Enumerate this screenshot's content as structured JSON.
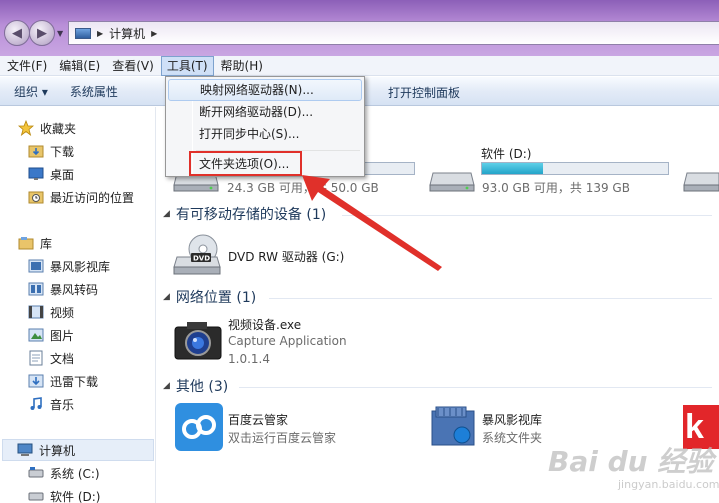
{
  "address": {
    "crumb": "计算机"
  },
  "menubar": [
    {
      "label": "文件(F)"
    },
    {
      "label": "编辑(E)"
    },
    {
      "label": "查看(V)"
    },
    {
      "label": "工具(T)"
    },
    {
      "label": "帮助(H)"
    }
  ],
  "cmdbar": {
    "organize": "组织 ▾",
    "properties": "系统属性",
    "control_panel": "打开控制面板"
  },
  "tools_menu": {
    "items": [
      {
        "label": "映射网络驱动器(N)..."
      },
      {
        "label": "断开网络驱动器(D)..."
      },
      {
        "label": "打开同步中心(S)..."
      },
      {
        "label": "文件夹选项(O)..."
      }
    ]
  },
  "nav": {
    "favorites": "收藏夹",
    "downloads": "下载",
    "desktop": "桌面",
    "recent": "最近访问的位置",
    "libraries": "库",
    "lib_video_lib": "暴风影视库",
    "lib_transcode": "暴风转码",
    "lib_videos": "视频",
    "lib_pictures": "图片",
    "lib_docs": "文档",
    "lib_xunlei": "迅雷下载",
    "lib_music": "音乐",
    "computer": "计算机",
    "sys_c": "系统 (C:)",
    "soft_d": "软件 (D:)"
  },
  "drives": {
    "c_free": "24.3 GB 可用，共 50.0 GB",
    "c_fill": 0.51,
    "d_name": "软件 (D:)",
    "d_free": "93.0 GB 可用，共 139 GB",
    "d_fill": 0.33
  },
  "groups": {
    "removable": "有可移动存储的设备 (1)",
    "network": "网络位置 (1)",
    "other": "其他 (3)"
  },
  "dvd": {
    "name": "DVD RW 驱动器 (G:)"
  },
  "network_item": {
    "name": "视频设备.exe",
    "desc": "Capture Application",
    "version": "1.0.1.4"
  },
  "other_items": [
    {
      "name": "百度云管家",
      "desc": "双击运行百度云管家"
    },
    {
      "name": "暴风影视库",
      "desc": "系统文件夹"
    }
  ],
  "watermark": {
    "main": "Bai du 经验",
    "sub": "jingyan.baidu.com"
  },
  "colors": {
    "annotation_red": "#e0302a",
    "accent_blue": "#1e395b"
  }
}
